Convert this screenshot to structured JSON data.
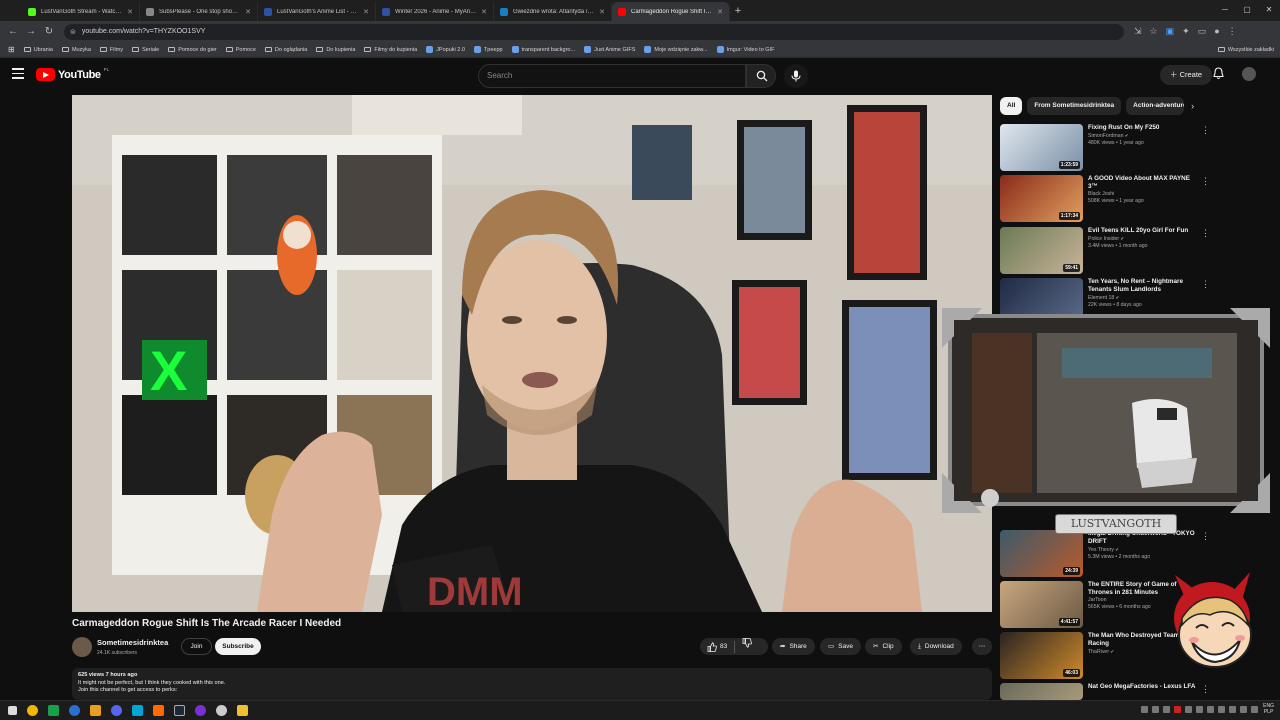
{
  "browser": {
    "tabs": [
      {
        "title": "LustVanGoth Stream - Watch L...",
        "color": "#53fc18",
        "active": false
      },
      {
        "title": "SubsPlease - One stop shop fo...",
        "color": "#888888",
        "active": false
      },
      {
        "title": "LustVanGoth's Anime List - My...",
        "color": "#2e51a2",
        "active": false
      },
      {
        "title": "Winter 2026 - Anime - MyAnim...",
        "color": "#2e51a2",
        "active": false
      },
      {
        "title": "Gwiezdne wrota: Atlantyda / Sz...",
        "color": "#1a7fc1",
        "active": false
      },
      {
        "title": "Carmageddon Rogue Shift Is Th...",
        "color": "#ff0000",
        "active": true
      }
    ],
    "url": "youtube.com/watch?v=THYZKOO1SVY",
    "bookmarks": [
      {
        "label": "Ubrania",
        "type": "folder"
      },
      {
        "label": "Muzyka",
        "type": "folder"
      },
      {
        "label": "Filmy",
        "type": "folder"
      },
      {
        "label": "Seriale",
        "type": "folder"
      },
      {
        "label": "Pomoce do gier",
        "type": "folder"
      },
      {
        "label": "Pomoce",
        "type": "folder"
      },
      {
        "label": "Do oglądania",
        "type": "folder"
      },
      {
        "label": "Do kupienia",
        "type": "folder"
      },
      {
        "label": "Filmy do kupienia",
        "type": "folder"
      },
      {
        "label": "JPopuki 2.0",
        "type": "site"
      },
      {
        "label": "Tpeepp",
        "type": "site"
      },
      {
        "label": "transparent backgro...",
        "type": "site"
      },
      {
        "label": "Just Anime GIFS",
        "type": "site"
      },
      {
        "label": "Moje wdzięnie zakw...",
        "type": "site"
      },
      {
        "label": "Imgur: Video to GIF",
        "type": "site"
      }
    ],
    "all_bookmarks": "Wszystkie zakładki"
  },
  "youtube": {
    "logo_text": "YouTube",
    "country_code": "PL",
    "search_placeholder": "Search",
    "create_label": "Create"
  },
  "video": {
    "title": "Carmageddon Rogue Shift Is The Arcade Racer I Needed",
    "channel": "Sometimesidrinktea",
    "subscribers": "24.1K subscribers",
    "join_label": "Join",
    "subscribe_label": "Subscribe",
    "likes": "83",
    "share_label": "Share",
    "save_label": "Save",
    "clip_label": "Clip",
    "download_label": "Download",
    "views_time": "625 views  7 hours ago",
    "desc_line1": "It might not be perfect, but I think they cooked with this one.",
    "desc_line2": "Join this channel to get access to perks:"
  },
  "chips": [
    "All",
    "From Sometimesidrinktea",
    "Action-adventure"
  ],
  "recommendations": [
    {
      "title": "Fixing Rust On My F250",
      "channel": "SimonFordman",
      "meta": "480K views • 1 year ago",
      "duration": "1:23:59",
      "verified": true
    },
    {
      "title": "A GOOD Video About MAX PAYNE 3™",
      "channel": "Black Joshi",
      "meta": "508K views • 1 year ago",
      "duration": "1:17:34",
      "verified": false
    },
    {
      "title": "Evil Teens KILL 20yo Girl For Fun",
      "channel": "Police Insider",
      "meta": "3.4M views • 1 month ago",
      "duration": "59:41",
      "verified": true
    },
    {
      "title": "Ten Years, No Rent – Nightmare Tenants Slum Landlords",
      "channel": "Element 18",
      "meta": "22K views • 8 days ago",
      "duration": "",
      "verified": true
    },
    {
      "title": "Illegal Drifting Underworld - TOKYO DRIFT",
      "channel": "Yes Theory",
      "meta": "5.3M views • 2 months ago",
      "duration": "24:39",
      "verified": true
    },
    {
      "title": "The ENTIRE Story of Game of Thrones in 281 Minutes",
      "channel": "JarToon",
      "meta": "565K views • 6 months ago",
      "duration": "4:41:57",
      "verified": false
    },
    {
      "title": "The Man Who Destroyed Team Racing",
      "channel": "ThaRiver",
      "meta": "",
      "duration": "46:03",
      "verified": true
    },
    {
      "title": "Nat Geo MegaFactories - Lexus LFA",
      "channel": "",
      "meta": "",
      "duration": "",
      "verified": false
    }
  ],
  "overlay": {
    "streamer_name": "LUSTVANGOTH"
  },
  "taskbar": {
    "lang_top": "ENG",
    "lang_bottom": "PLP"
  }
}
